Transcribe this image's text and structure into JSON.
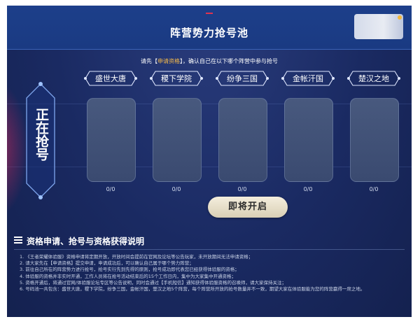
{
  "header": {
    "title": "阵营势力抢号池"
  },
  "notice": {
    "prefix": "请先【",
    "link": "申请资格",
    "suffix": "】，确认自己在以下哪个阵营中参与抢号"
  },
  "status_label": "正在抢号",
  "factions": [
    {
      "name": "盛世大唐",
      "count": "0/0"
    },
    {
      "name": "稷下学院",
      "count": "0/0"
    },
    {
      "name": "纷争三国",
      "count": "0/0"
    },
    {
      "name": "金帐汗国",
      "count": "0/0"
    },
    {
      "name": "楚汉之地",
      "count": "0/0"
    }
  ],
  "open_button": "即将开启",
  "info": {
    "title": "资格申请、抢号与资格获得说明",
    "rules": [
      "1. 《王者荣耀体验服》资格申请将定期开放，开放时间会提前在官网及论坛等公告玩家，未开放期间无法申请资格；",
      "2. 请大家先在【申请资格】提交申请，申请成功后，可以确认自己属于哪个势力阵营；",
      "3. 前往自己所在的阵营势力进行抢号，抢号实行先到先得的原则，抢号成功即代表您已经获得体验服的资格；",
      "4. 体验服的资格并非实时开通，工作人员将在抢号活动结束后的15个工作日内，集中为大家集中开通资格；",
      "5. 资格开通后，将通过官网/体验服论坛专区等公告说明，同时会通过【手机短信】通知获得体验服资格的召唤师，请大家保持关注；",
      "6. 号码池一共包含：盛世大唐，稷下学院，纷争三国，金帐汗国，楚汉之地5个阵营，每个阵营所开放的抢号数量并不一致，期望大家在体验服能为您的阵营赢得一席之地。"
    ]
  },
  "colors": {
    "background": "#1a2a62",
    "header": "#1d3f8a",
    "highlight": "#f2b84a",
    "button": "#e8e0c8"
  }
}
